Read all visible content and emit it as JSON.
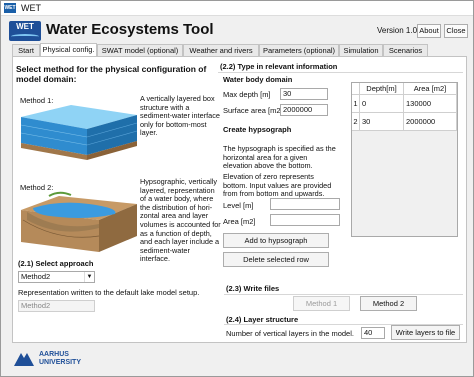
{
  "window": {
    "app_icon": "WET",
    "title": "WET"
  },
  "header": {
    "logo_text": "WET",
    "title": "Water Ecosystems Tool",
    "version": "Version 1.0",
    "about_label": "About",
    "close_label": "Close"
  },
  "tabs": [
    {
      "label": "Start"
    },
    {
      "label": "Physical config."
    },
    {
      "label": "SWAT model (optional)"
    },
    {
      "label": "Weather and rivers"
    },
    {
      "label": "Parameters (optional)"
    },
    {
      "label": "Simulation"
    },
    {
      "label": "Scenarios"
    }
  ],
  "left": {
    "heading": "Select method for the physical configuration of model domain:",
    "method1": {
      "label": "Method 1:",
      "description": "A vertically layered box\nstructure with a\nsediment-water interface\nonly for bottom-most\nlayer."
    },
    "method2": {
      "label": "Method 2:",
      "description": "Hypsographic, vertically\nlayered, representation\nof a water body, where\nthe distribution of hori-\nzontal area and layer\nvolumes is accounted for\nas a function of depth,\nand each layer include a\nsediment-water\ninterface."
    },
    "select_heading": "(2.1) Select approach",
    "selected_method": "Method2",
    "representation_text": "Representation written to the default lake model setup.",
    "representation_value": "Method2"
  },
  "section22": {
    "heading": "(2.2) Type in relevant information",
    "water_body_heading": "Water body domain",
    "max_depth_label": "Max depth [m]",
    "max_depth_value": "30",
    "surface_area_label": "Surface area [m2]",
    "surface_area_value": "2000000",
    "hypsograph_heading": "Create hypsograph",
    "hypsograph_text": "The hypsograph is specified as the\nhorizontal area for a given\nelevation above the bottom.",
    "zero_text": "Elevation of zero represents\nbottom. Input values are provided\nfrom from bottom and upwards.",
    "level_label": "Level [m]",
    "level_value": "",
    "area_label": "Area [m2]",
    "area_value": "",
    "add_button": "Add to hypsograph",
    "delete_button": "Delete selected row",
    "table": {
      "columns": [
        "Depth[m]",
        "Area [m2]"
      ],
      "rows": [
        {
          "index": "1",
          "depth": "0",
          "area": "130000"
        },
        {
          "index": "2",
          "depth": "30",
          "area": "2000000"
        }
      ]
    }
  },
  "section23": {
    "heading": "(2.3) Write files",
    "method1_button": "Method 1",
    "method2_button": "Method 2"
  },
  "section24": {
    "heading": "(2.4) Layer structure",
    "layers_label": "Number of vertical layers in the model.",
    "layers_value": "40",
    "write_button": "Write layers to file"
  },
  "footer": {
    "university_line1": "AARHUS",
    "university_line2": "UNIVERSITY"
  },
  "colors": {
    "accent": "#1f4f98",
    "water": "#4aa3dc",
    "soil": "#b58a5a"
  }
}
